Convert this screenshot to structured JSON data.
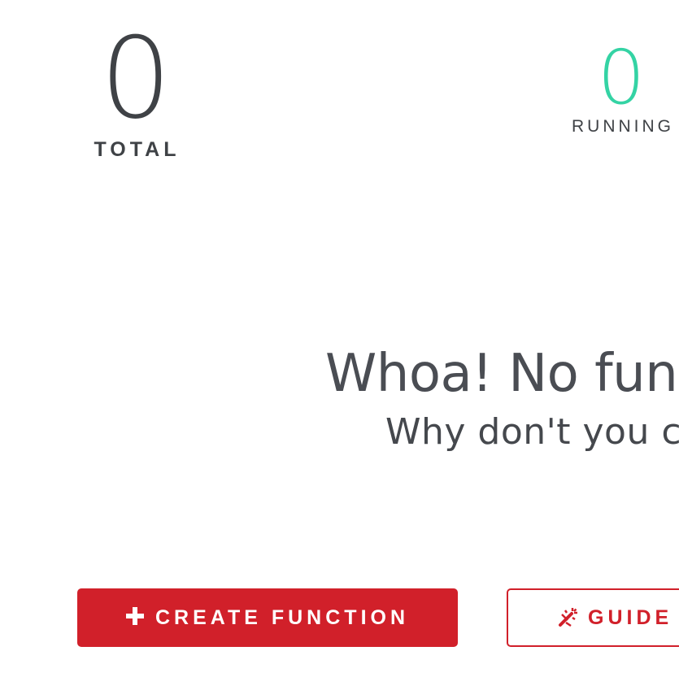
{
  "stats": {
    "total": {
      "value": "0",
      "label": "TOTAL"
    },
    "running": {
      "value": "0",
      "label": "RUNNING"
    }
  },
  "empty_state": {
    "title": "Whoa! No func",
    "subtitle": "Why don't you cre"
  },
  "actions": {
    "create_icon": "plus-icon",
    "create_label": "CREATE FUNCTION",
    "guide_icon": "magic-wand-icon",
    "guide_label": "GUIDE"
  },
  "colors": {
    "accent": "#d1202a",
    "running": "#34d3a4",
    "text": "#3f4246"
  }
}
